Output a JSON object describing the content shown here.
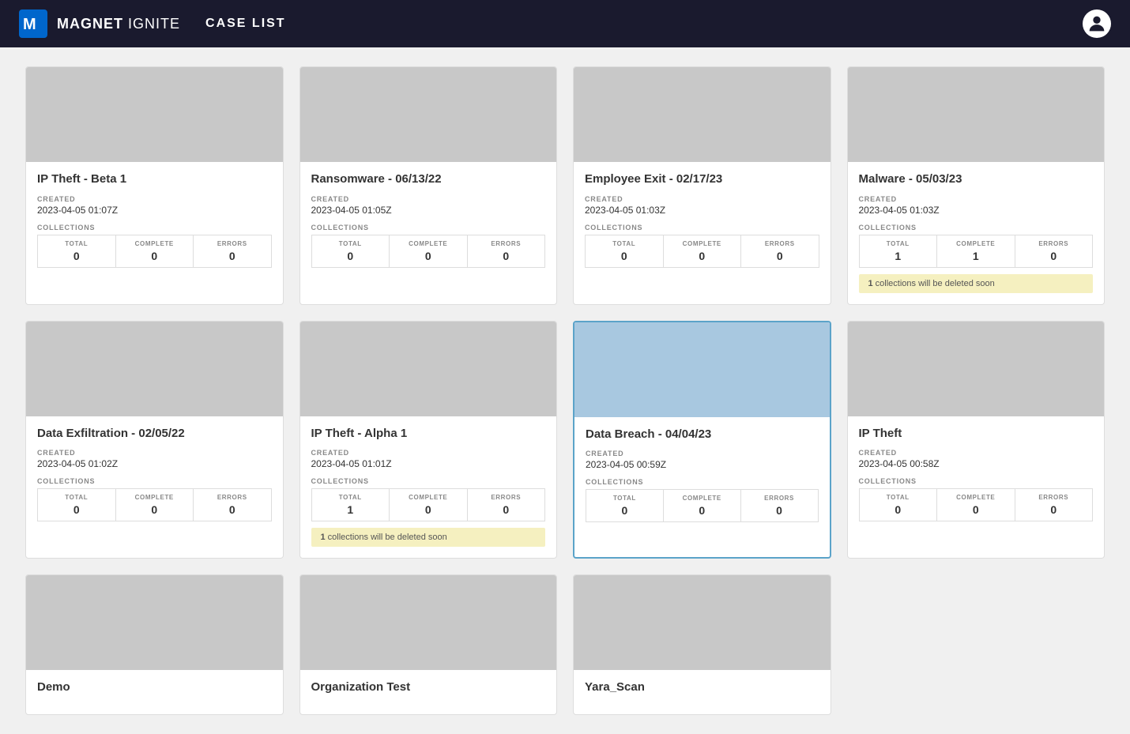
{
  "header": {
    "brand": "MAGNET",
    "brand_sub": "IGNITE",
    "page_title": "CASE LIST",
    "user_icon": "person"
  },
  "cases": [
    {
      "id": "ip-theft-beta-1",
      "title": "IP Theft - Beta 1",
      "created_label": "CREATED",
      "created_value": "2023-04-05 01:07Z",
      "collections_label": "COLLECTIONS",
      "total_label": "TOTAL",
      "total": "0",
      "complete_label": "COMPLETE",
      "complete": "0",
      "errors_label": "ERRORS",
      "errors": "0",
      "highlighted": false,
      "warning": null
    },
    {
      "id": "ransomware",
      "title": "Ransomware - 06/13/22",
      "created_label": "CREATED",
      "created_value": "2023-04-05 01:05Z",
      "collections_label": "COLLECTIONS",
      "total_label": "TOTAL",
      "total": "0",
      "complete_label": "COMPLETE",
      "complete": "0",
      "errors_label": "ERRORS",
      "errors": "0",
      "highlighted": false,
      "warning": null
    },
    {
      "id": "employee-exit",
      "title": "Employee Exit - 02/17/23",
      "created_label": "CREATED",
      "created_value": "2023-04-05 01:03Z",
      "collections_label": "COLLECTIONS",
      "total_label": "TOTAL",
      "total": "0",
      "complete_label": "COMPLETE",
      "complete": "0",
      "errors_label": "ERRORS",
      "errors": "0",
      "highlighted": false,
      "warning": null
    },
    {
      "id": "malware",
      "title": "Malware - 05/03/23",
      "created_label": "CREATED",
      "created_value": "2023-04-05 01:03Z",
      "collections_label": "COLLECTIONS",
      "total_label": "TOTAL",
      "total": "1",
      "complete_label": "COMPLETE",
      "complete": "1",
      "errors_label": "ERRORS",
      "errors": "0",
      "highlighted": false,
      "warning": "1 collections will be deleted soon"
    },
    {
      "id": "data-exfiltration",
      "title": "Data Exfiltration - 02/05/22",
      "created_label": "CREATED",
      "created_value": "2023-04-05 01:02Z",
      "collections_label": "COLLECTIONS",
      "total_label": "TOTAL",
      "total": "0",
      "complete_label": "COMPLETE",
      "complete": "0",
      "errors_label": "ERRORS",
      "errors": "0",
      "highlighted": false,
      "warning": null
    },
    {
      "id": "ip-theft-alpha-1",
      "title": "IP Theft - Alpha 1",
      "created_label": "CREATED",
      "created_value": "2023-04-05 01:01Z",
      "collections_label": "COLLECTIONS",
      "total_label": "TOTAL",
      "total": "1",
      "complete_label": "COMPLETE",
      "complete": "0",
      "errors_label": "ERRORS",
      "errors": "0",
      "highlighted": false,
      "warning": "1 collections will be deleted soon"
    },
    {
      "id": "data-breach",
      "title": "Data Breach - 04/04/23",
      "created_label": "CREATED",
      "created_value": "2023-04-05 00:59Z",
      "collections_label": "COLLECTIONS",
      "total_label": "TOTAL",
      "total": "0",
      "complete_label": "COMPLETE",
      "complete": "0",
      "errors_label": "ERRORS",
      "errors": "0",
      "highlighted": true,
      "warning": null
    },
    {
      "id": "ip-theft",
      "title": "IP Theft",
      "created_label": "CREATED",
      "created_value": "2023-04-05 00:58Z",
      "collections_label": "COLLECTIONS",
      "total_label": "TOTAL",
      "total": "0",
      "complete_label": "COMPLETE",
      "complete": "0",
      "errors_label": "ERRORS",
      "errors": "0",
      "highlighted": false,
      "warning": null
    },
    {
      "id": "demo",
      "title": "Demo",
      "created_label": null,
      "created_value": null,
      "collections_label": null,
      "total_label": null,
      "total": null,
      "complete_label": null,
      "complete": null,
      "errors_label": null,
      "errors": null,
      "highlighted": false,
      "warning": null,
      "partial": true
    },
    {
      "id": "organization-test",
      "title": "Organization Test",
      "created_label": null,
      "created_value": null,
      "collections_label": null,
      "total_label": null,
      "total": null,
      "complete_label": null,
      "complete": null,
      "errors_label": null,
      "errors": null,
      "highlighted": false,
      "warning": null,
      "partial": true
    },
    {
      "id": "yara-scan",
      "title": "Yara_Scan",
      "created_label": null,
      "created_value": null,
      "collections_label": null,
      "total_label": null,
      "total": null,
      "complete_label": null,
      "complete": null,
      "errors_label": null,
      "errors": null,
      "highlighted": false,
      "warning": null,
      "partial": true
    }
  ]
}
